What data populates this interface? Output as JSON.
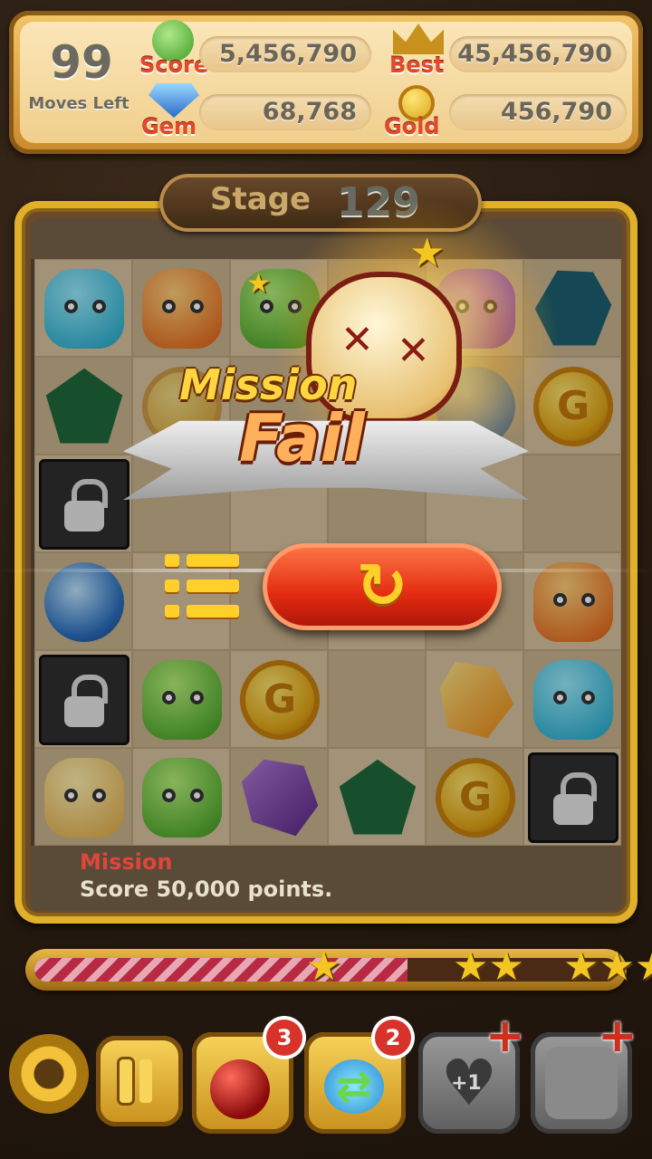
{
  "hud": {
    "moves_left": "99",
    "moves_label": "Moves Left",
    "score_label": "Score",
    "score_value": "5,456,790",
    "best_label": "Best",
    "best_value": "45,456,790",
    "gem_label": "Gem",
    "gem_value": "68,768",
    "gold_label": "Gold",
    "gold_value": "456,790"
  },
  "stage": {
    "label": "Stage",
    "number": "129"
  },
  "result": {
    "line1": "Mission",
    "line2": "Fail"
  },
  "coin_letter": "G",
  "mission": {
    "label": "Mission",
    "text": "Score 50,000 points."
  },
  "progress": {
    "fill_fraction": 0.64,
    "stars": 3
  },
  "items": {
    "bomb_count": "3",
    "shuffle_count": "2",
    "heart_label": "+1"
  },
  "colors": {
    "accent_gold": "#e0b02a",
    "retry_red": "#e22a10",
    "mission_red": "#e0463a"
  },
  "icons": [
    "settings-gear-icon",
    "pause-icon",
    "bomb-icon",
    "shuffle-icon",
    "heart-plus-icon",
    "empty-slot-icon",
    "retry-icon",
    "list-menu-icon"
  ]
}
